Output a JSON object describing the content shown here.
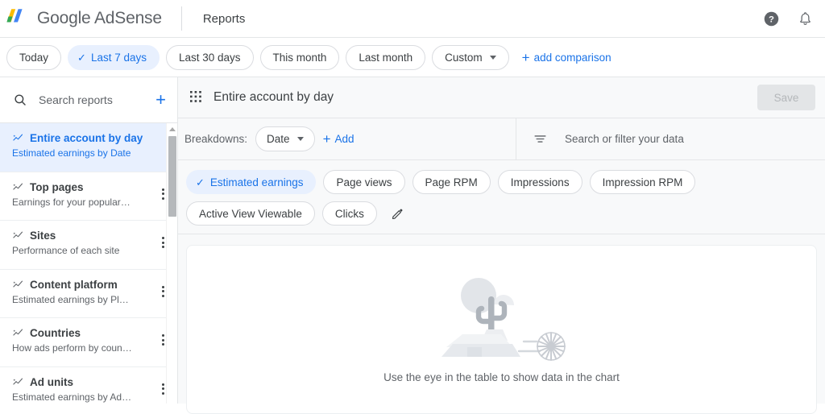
{
  "header": {
    "brand": "Google AdSense",
    "brand_logo_icon": "adsense-logo-icon",
    "page_title": "Reports",
    "help_icon": "help-icon",
    "notifications_icon": "bell-icon"
  },
  "date_filters": {
    "chips": [
      {
        "label": "Today",
        "selected": false,
        "dropdown": false
      },
      {
        "label": "Last 7 days",
        "selected": true,
        "dropdown": false
      },
      {
        "label": "Last 30 days",
        "selected": false,
        "dropdown": false
      },
      {
        "label": "This month",
        "selected": false,
        "dropdown": false
      },
      {
        "label": "Last month",
        "selected": false,
        "dropdown": false
      },
      {
        "label": "Custom",
        "selected": false,
        "dropdown": true
      }
    ],
    "add_comparison_label": "add comparison",
    "add_comparison_icon": "plus-icon",
    "check_glyph": "✓"
  },
  "sidebar": {
    "search": {
      "placeholder": "Search reports",
      "icon": "search-icon",
      "add_icon": "plus-icon"
    },
    "items": [
      {
        "title": "Entire account by day",
        "subtitle": "Estimated earnings by Date",
        "icon": "trending-sparkline-icon",
        "active": true,
        "has_kebab": false
      },
      {
        "title": "Top pages",
        "subtitle": "Earnings for your popular pa…",
        "icon": "trending-sparkline-icon",
        "active": false,
        "has_kebab": true
      },
      {
        "title": "Sites",
        "subtitle": "Performance of each site",
        "icon": "trending-sparkline-icon",
        "active": false,
        "has_kebab": true
      },
      {
        "title": "Content platform",
        "subtitle": "Estimated earnings by Platfo…",
        "icon": "trending-sparkline-icon",
        "active": false,
        "has_kebab": true
      },
      {
        "title": "Countries",
        "subtitle": "How ads perform by country",
        "icon": "trending-sparkline-icon",
        "active": false,
        "has_kebab": true
      },
      {
        "title": "Ad units",
        "subtitle": "Estimated earnings by Ad unit",
        "icon": "trending-sparkline-icon",
        "active": false,
        "has_kebab": true
      }
    ],
    "kebab_icon": "more-vertical-icon",
    "scrollbar_up_icon": "scroll-up-arrow-icon"
  },
  "report": {
    "grid_icon": "apps-grid-icon",
    "title": "Entire account by day",
    "save_label": "Save",
    "save_disabled": true
  },
  "breakdowns": {
    "label": "Breakdowns:",
    "selected": "Date",
    "add_label": "Add",
    "add_icon": "plus-icon",
    "filter_icon": "filter-icon",
    "filter_placeholder": "Search or filter your data"
  },
  "metrics": {
    "check_glyph": "✓",
    "edit_icon": "pencil-icon",
    "chips": [
      {
        "label": "Estimated earnings",
        "selected": true
      },
      {
        "label": "Page views",
        "selected": false
      },
      {
        "label": "Page RPM",
        "selected": false
      },
      {
        "label": "Impressions",
        "selected": false
      },
      {
        "label": "Impression RPM",
        "selected": false
      },
      {
        "label": "Active View Viewable",
        "selected": false
      },
      {
        "label": "Clicks",
        "selected": false
      }
    ]
  },
  "chart_panel": {
    "empty_illustration_icon": "desert-cactus-tumbleweed-illustration",
    "empty_message": "Use the eye in the table to show data in the chart"
  },
  "colors": {
    "accent_blue": "#1a73e8",
    "chip_selected_bg": "#e8f0fe",
    "text_primary": "#3c4043",
    "text_secondary": "#5f6368",
    "border": "#dadce0",
    "panel_bg": "#f8f9fa"
  }
}
